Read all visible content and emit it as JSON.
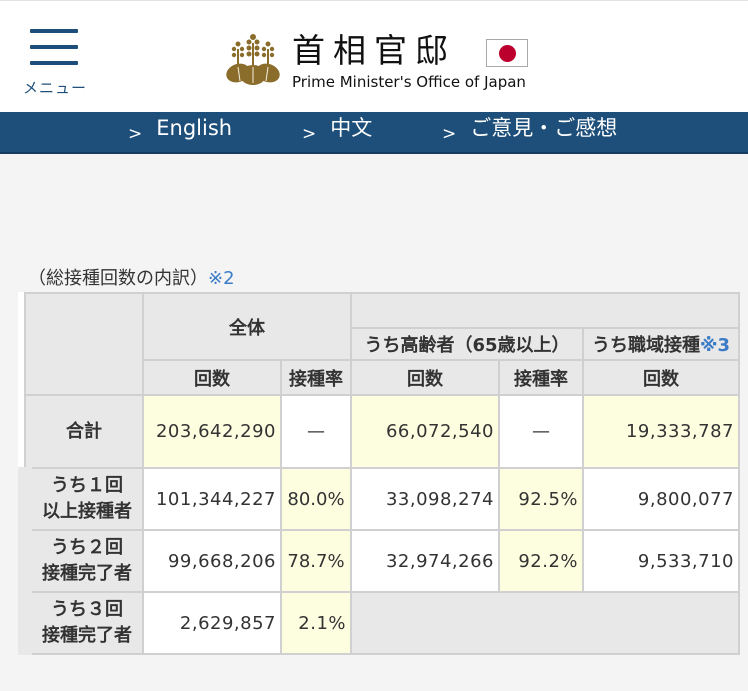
{
  "header": {
    "menu_label": "メニュー",
    "title_jp": "首相官邸",
    "title_en": "Prime Minister's Office of Japan"
  },
  "nav": {
    "items": [
      {
        "label": "English"
      },
      {
        "label": "中文"
      },
      {
        "label": "ご意見・ご感想"
      }
    ]
  },
  "section": {
    "caption": "（総接種回数の内訳）",
    "caption_note": "※2"
  },
  "table": {
    "group_all": "全体",
    "group_elderly": "うち高齢者（65歳以上）",
    "group_workplace": "うち職域接種",
    "group_workplace_note": "※3",
    "sub_count": "回数",
    "sub_rate": "接種率",
    "rows": [
      {
        "label_1": "合計",
        "label_2": "",
        "all_count": "203,642,290",
        "all_rate": "—",
        "eld_count": "66,072,540",
        "eld_rate": "—",
        "work_count": "19,333,787"
      },
      {
        "label_1": "うち１回",
        "label_2": "以上接種者",
        "all_count": "101,344,227",
        "all_rate": "80.0%",
        "eld_count": "33,098,274",
        "eld_rate": "92.5%",
        "work_count": "9,800,077"
      },
      {
        "label_1": "うち２回",
        "label_2": "接種完了者",
        "all_count": "99,668,206",
        "all_rate": "78.7%",
        "eld_count": "32,974,266",
        "eld_rate": "92.2%",
        "work_count": "9,533,710"
      },
      {
        "label_1": "うち３回",
        "label_2": "接種完了者",
        "all_count": "2,629,857",
        "all_rate": "2.1%",
        "eld_count": "",
        "eld_rate": "",
        "work_count": ""
      }
    ]
  }
}
